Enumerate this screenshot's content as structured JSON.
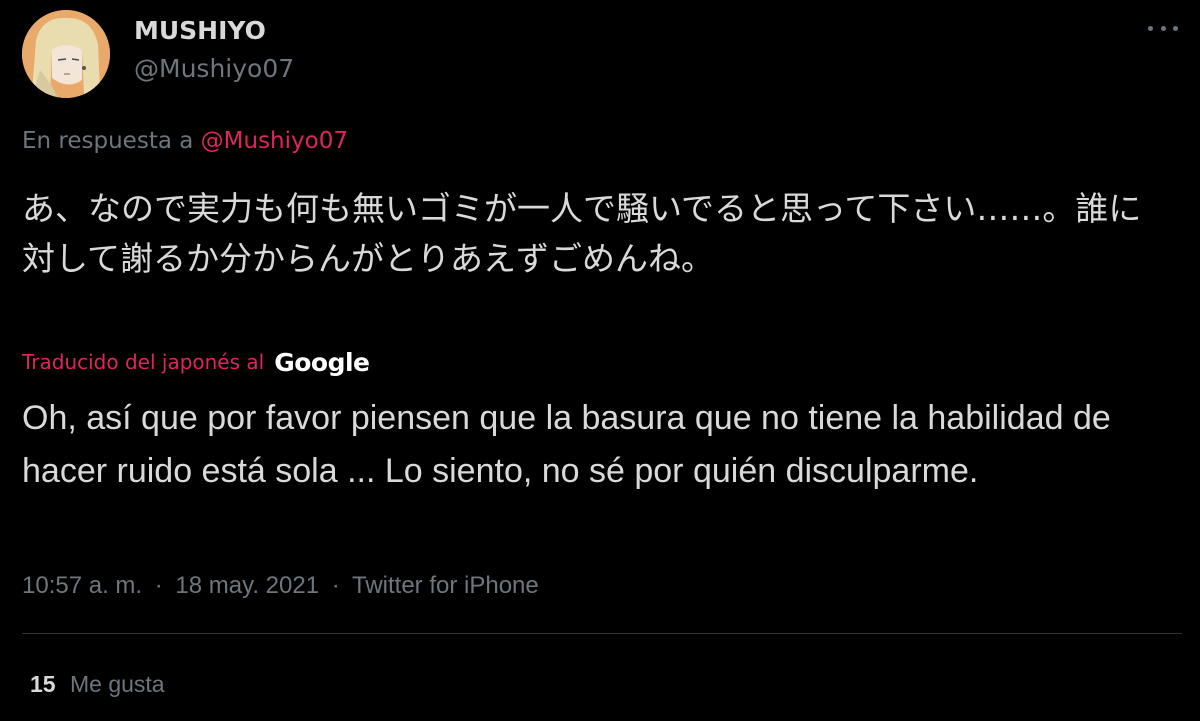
{
  "tweet": {
    "author": {
      "display_name": "MUSHIYO",
      "handle": "@Mushiyo07"
    },
    "reply": {
      "prefix": "En respuesta a",
      "mention": "@Mushiyo07"
    },
    "original_text": "あ、なので実力も何も無いゴミが一人で騒いでると思って下さい……。誰に対して謝るか分からんがとりあえずごめんね。",
    "translation": {
      "label": "Traducido del japonés al",
      "provider": "Google",
      "text": "Oh, así que por favor piensen que la basura que no tiene la habilidad de hacer ruido está sola ... Lo siento, no sé por quién disculparme."
    },
    "meta": {
      "time": "10:57 a. m.",
      "separator": "·",
      "date": "18 may. 2021",
      "source": "Twitter for iPhone"
    },
    "likes": {
      "count": "15",
      "label": "Me gusta"
    }
  },
  "colors": {
    "background": "#000000",
    "text": "#d9d9d9",
    "muted": "#6e767d",
    "accent": "#e0245e",
    "divider": "#2f3336"
  },
  "icons": {
    "more": "more-horizontal-icon"
  }
}
